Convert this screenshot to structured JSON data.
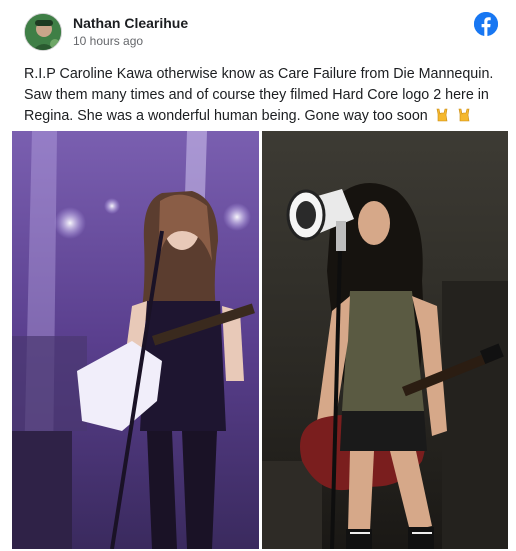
{
  "post": {
    "author": "Nathan Clearihue",
    "time": "10 hours ago",
    "text": "R.I.P Caroline Kawa otherwise know as Care Failure from Die Mannequin. Saw them many times and of course they filmed Hard Core logo 2 here in Regina. She was a wonderful human being. Gone way too soon",
    "emoji": [
      "sign-of-the-horns-emoji",
      "sign-of-the-horns-emoji"
    ]
  },
  "colors": {
    "facebook_blue": "#1877f2",
    "text": "#1c1e21",
    "secondary_text": "#65676b"
  },
  "photos": [
    {
      "name": "photo-left",
      "description_icon": "concert-photo-purple"
    },
    {
      "name": "photo-right",
      "description_icon": "concert-photo-dark"
    }
  ]
}
